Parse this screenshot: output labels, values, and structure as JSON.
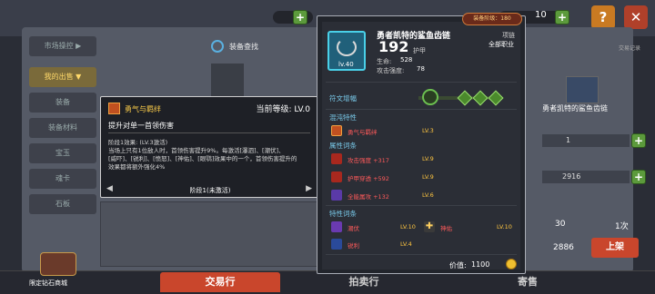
{
  "topbar": {
    "resource_a": "",
    "resource_b": "10",
    "plus_label": "+",
    "help_label": "?"
  },
  "equip_tag": "装备阶级：180",
  "left_menu": [
    "市场操控 ▶",
    "我的出售 ▼",
    "装备",
    "装备材料",
    "宝玉",
    "魂卡",
    "石板"
  ],
  "search_label": "装备查找",
  "tooltip": {
    "title": "勇气与羁绊",
    "level_label": "当前等级: LV.0",
    "subtitle": "提升对单一首领伤害",
    "desc": "阶段1效果: (LV.3激活)\n当场上只有1位敌人时，首领伤害提升9%。每激活[瀑泗]、[潮伏]、\n[威吓]、[锐利]、[愤怒]、[神佑]、[眼鹗]效果中的一个，首领伤害提升的\n效果都将额外强化4%",
    "stage_label": "阶段1(未激活)",
    "prev_arrow": "◀",
    "next_arrow": "▶"
  },
  "item": {
    "name": "勇者凯特的鲨鱼齿链",
    "slot": "项链",
    "class": "全部职业",
    "level": "lv.40",
    "armor_value": "192",
    "armor_label": "护甲",
    "stat1_label": "生命:",
    "stat1_value": "528",
    "stat2_label": "攻击强度:",
    "stat2_value": "78",
    "rune_label": "符文增幅",
    "chaos_header": "混沌特性",
    "chaos_name": "勇气与羁绊",
    "chaos_lv": "LV.3",
    "attr_header": "属性词条",
    "attrs": [
      {
        "name": "攻击强度 +317",
        "lv": "LV.9"
      },
      {
        "name": "护甲穿透 +592",
        "lv": "LV.9"
      },
      {
        "name": "全能属攻 +132",
        "lv": "LV.6"
      }
    ],
    "trait_header": "特性词条",
    "traits": [
      {
        "name": "潮伏",
        "lv": "LV.10"
      },
      {
        "name": "神佑",
        "lv": "LV.10"
      },
      {
        "name": "锐利",
        "lv": "LV.4"
      }
    ],
    "price_label": "价值:",
    "price_value": "1100"
  },
  "right_panel": {
    "name": "勇者凯特的鲨鱼齿链",
    "history": "交易记录",
    "qty": "1",
    "price": "2916",
    "fee_label": "",
    "fee_value": "30",
    "trade_count": "1次",
    "total": "2886",
    "list_btn": "上架"
  },
  "bottom_tabs": [
    "交易行",
    "拍卖行",
    "寄售"
  ],
  "limit_shop": "限定钻石商城",
  "colors": {
    "accent_red": "#c9462c",
    "level_gold": "#ffc640",
    "attr_red": "#ff5a5a",
    "section_cyan": "#78c8e8",
    "tooltip_gold": "#ffcf4a"
  }
}
